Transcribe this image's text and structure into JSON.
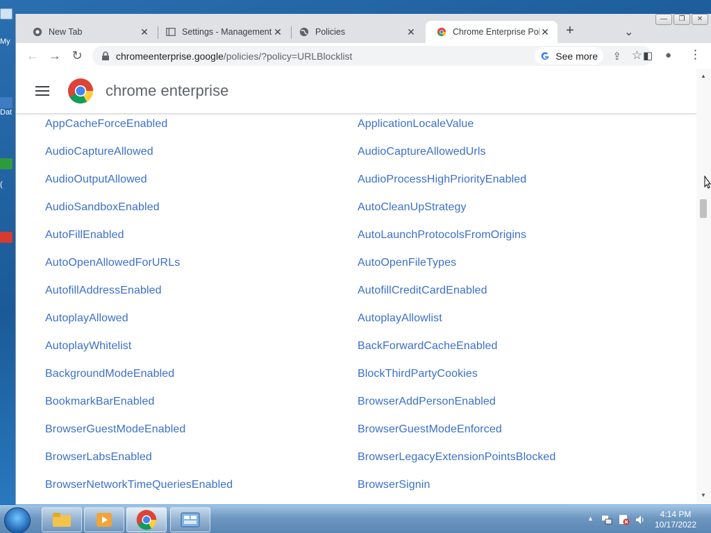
{
  "desktop": {
    "icon_labels": [
      "My",
      "Dat",
      "(",
      ""
    ]
  },
  "window_controls": {
    "minimize": "—",
    "restore": "❐",
    "close": "✕"
  },
  "tabs": [
    {
      "title": "New Tab",
      "close": "✕"
    },
    {
      "title": "Settings - Management",
      "close": "✕"
    },
    {
      "title": "Policies",
      "close": "✕"
    },
    {
      "title": "Chrome Enterprise Polic",
      "close": "✕"
    }
  ],
  "new_tab_label": "+",
  "tab_search_label": "⌄",
  "toolbar": {
    "back": "←",
    "forward": "→",
    "reload": "↻",
    "url_host": "chromeenterprise.google",
    "url_path": "/policies/?policy=URLBlocklist",
    "see_more": "See more",
    "share": "⇪",
    "bookmark": "☆",
    "side_panel": "◧",
    "profile": "●",
    "menu": "⋮"
  },
  "page": {
    "brand": "chrome enterprise",
    "policies": [
      [
        "AppCacheForceEnabled",
        "ApplicationLocaleValue"
      ],
      [
        "AudioCaptureAllowed",
        "AudioCaptureAllowedUrls"
      ],
      [
        "AudioOutputAllowed",
        "AudioProcessHighPriorityEnabled"
      ],
      [
        "AudioSandboxEnabled",
        "AutoCleanUpStrategy"
      ],
      [
        "AutoFillEnabled",
        "AutoLaunchProtocolsFromOrigins"
      ],
      [
        "AutoOpenAllowedForURLs",
        "AutoOpenFileTypes"
      ],
      [
        "AutofillAddressEnabled",
        "AutofillCreditCardEnabled"
      ],
      [
        "AutoplayAllowed",
        "AutoplayAllowlist"
      ],
      [
        "AutoplayWhitelist",
        "BackForwardCacheEnabled"
      ],
      [
        "BackgroundModeEnabled",
        "BlockThirdPartyCookies"
      ],
      [
        "BookmarkBarEnabled",
        "BrowserAddPersonEnabled"
      ],
      [
        "BrowserGuestModeEnabled",
        "BrowserGuestModeEnforced"
      ],
      [
        "BrowserLabsEnabled",
        "BrowserLegacyExtensionPointsBlocked"
      ],
      [
        "BrowserNetworkTimeQueriesEnabled",
        "BrowserSignin"
      ]
    ]
  },
  "scrollbar": {
    "up": "▲",
    "down": "▼",
    "position_fraction": 0.32
  },
  "taskbar": {
    "tray_expand": "▲",
    "time": "4:14 PM",
    "date": "10/17/2022"
  },
  "colors": {
    "link": "#3b6fcc",
    "tab_strip": "#dfe1e5",
    "omnibox": "#f1f3f4"
  }
}
